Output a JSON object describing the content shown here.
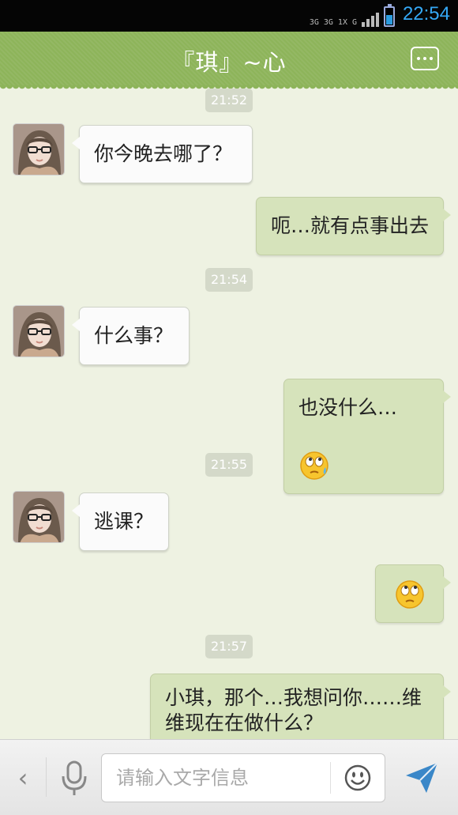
{
  "status_bar": {
    "network_labels": [
      "3G",
      "3G",
      "1X",
      "G"
    ],
    "time": "22:54",
    "time_color": "#35a8f5",
    "battery_level": 0.55
  },
  "header": {
    "title": "『琪』~心",
    "menu_icon": "more-dots-icon",
    "background_color": "#8db45a"
  },
  "messages": [
    {
      "type": "time",
      "text": "21:52"
    },
    {
      "type": "incoming",
      "text": "你今晚去哪了？"
    },
    {
      "type": "outgoing",
      "text": "呃…就有点事出去"
    },
    {
      "type": "time",
      "text": "21:54"
    },
    {
      "type": "incoming",
      "text": "什么事？"
    },
    {
      "type": "outgoing",
      "text": "也没什么…",
      "emoji": "sweat-emoji"
    },
    {
      "type": "time",
      "text": "21:55"
    },
    {
      "type": "incoming",
      "text": "逃课？"
    },
    {
      "type": "outgoing",
      "text": "",
      "emoji": "eye-roll-emoji"
    },
    {
      "type": "time",
      "text": "21:57"
    },
    {
      "type": "outgoing",
      "text": "小琪，那个…我想问你……维维现在在做什么？"
    }
  ],
  "input_bar": {
    "placeholder": "请输入文字信息",
    "value": "",
    "icons": [
      "back-chevron-icon",
      "microphone-icon",
      "emoji-smiley-icon",
      "send-arrow-icon"
    ]
  },
  "colors": {
    "incoming_bubble": "#fbfbfb",
    "outgoing_bubble": "#d6e3bb",
    "chat_background": "#eef2e2",
    "send_icon": "#3a87c8"
  }
}
